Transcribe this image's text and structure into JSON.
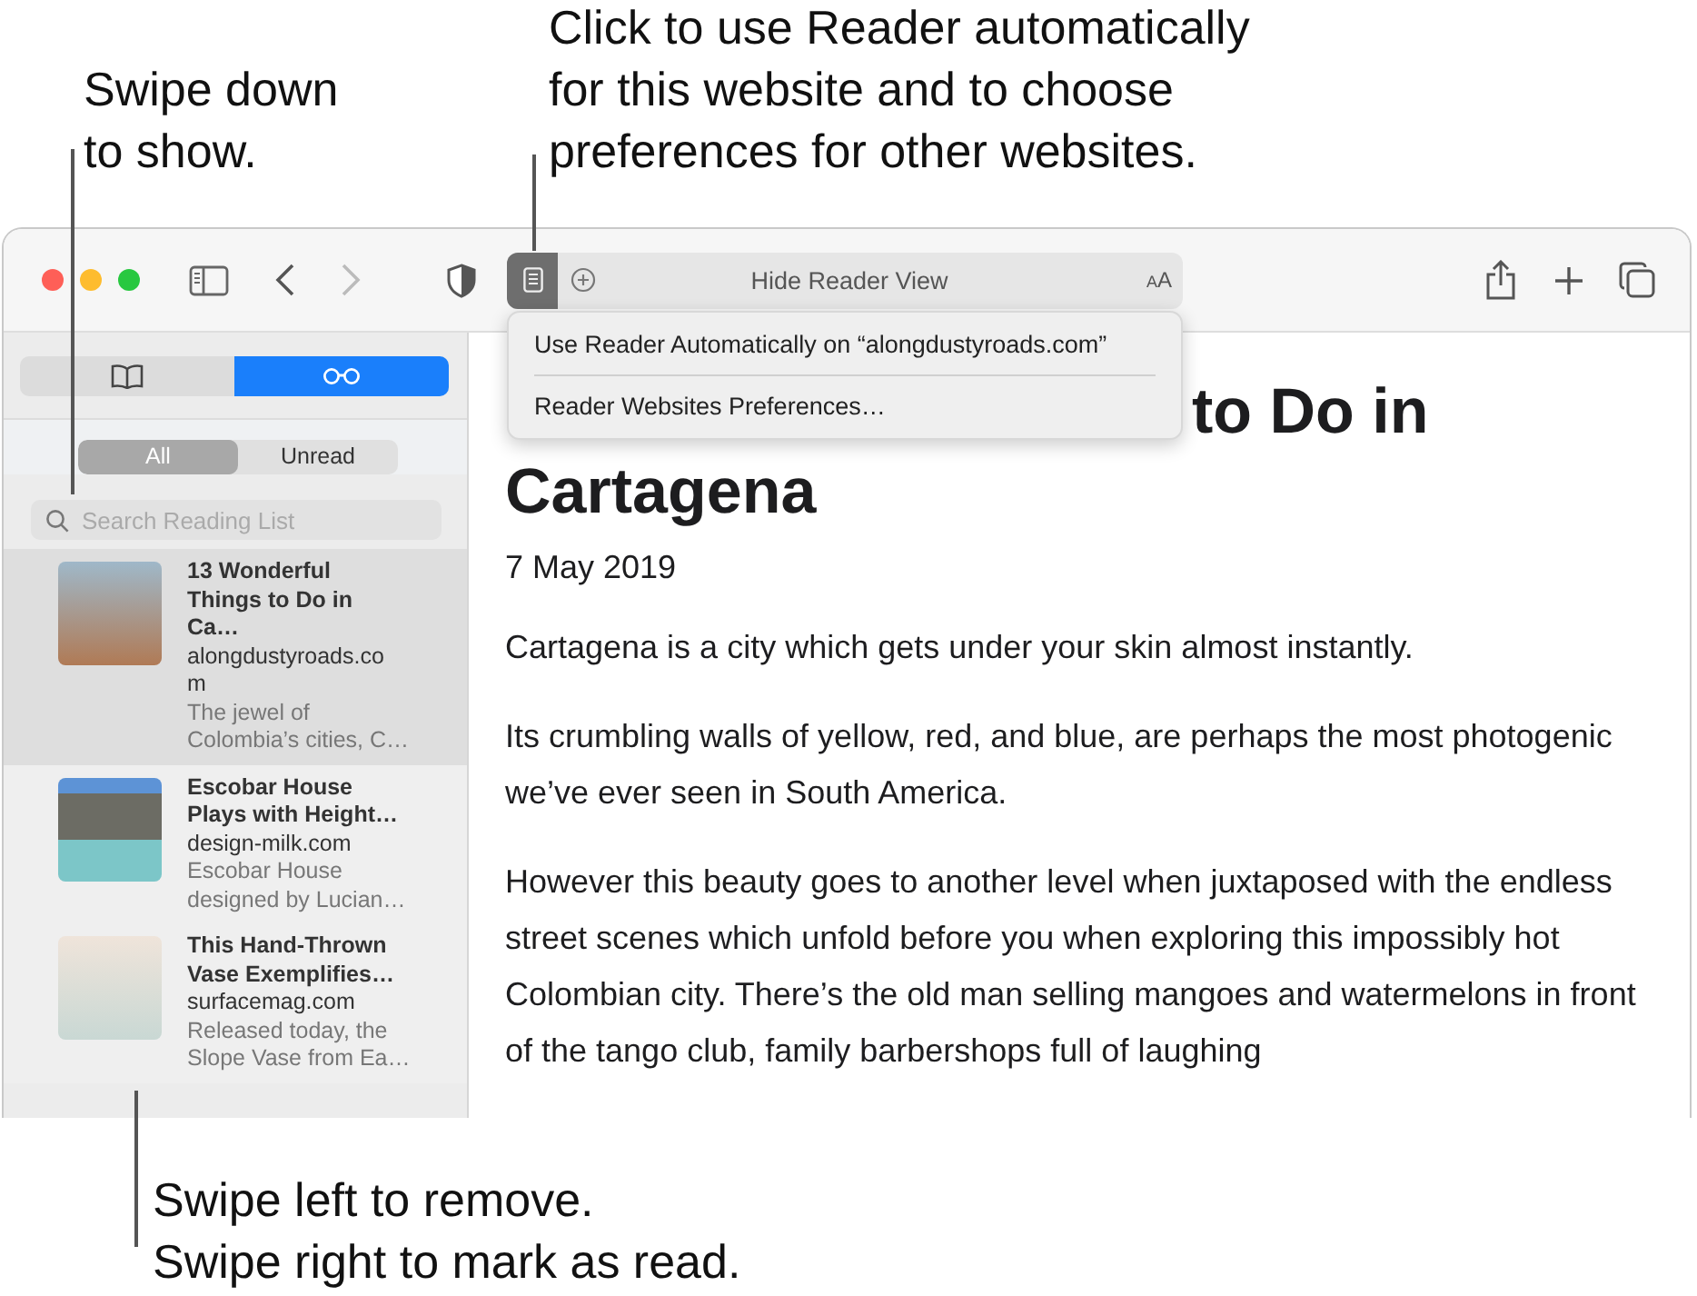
{
  "callouts": {
    "top_left": {
      "lines": [
        "Swipe down",
        "to show."
      ]
    },
    "top_center": {
      "lines": [
        "Click to use Reader automatically",
        "for this website and to choose",
        "preferences for other websites."
      ]
    },
    "bottom": {
      "lines": [
        "Swipe left to remove.",
        "Swipe right to mark as read."
      ]
    }
  },
  "toolbar": {
    "forward_disabled": true,
    "reader_active": true,
    "address_text": "Hide Reader View",
    "text_size_label": "AA"
  },
  "reader_menu": {
    "items": [
      {
        "label": "Use Reader Automatically on “alongdustyroads.com”"
      },
      {
        "label": "Reader Websites Preferences…"
      }
    ]
  },
  "sidebar": {
    "tabs": [
      {
        "kind": "bookmarks",
        "selected": false
      },
      {
        "kind": "reading-list",
        "selected": true
      }
    ],
    "filters": [
      {
        "label": "All",
        "selected": true
      },
      {
        "label": "Unread",
        "selected": false
      }
    ],
    "search": {
      "placeholder": "Search Reading List"
    },
    "items": [
      {
        "title": "13 Wonderful Things to Do in Ca…",
        "domain": "alongdustyroads.com",
        "summary": "The jewel of Colombia’s cities, C…",
        "selected": true
      },
      {
        "title": "Escobar House Plays with Height…",
        "domain": "design-milk.com",
        "summary": "Escobar House designed by Lucian…",
        "selected": false
      },
      {
        "title": "This Hand-Thrown Vase Exemplifies…",
        "domain": "surfacemag.com",
        "summary": "Released today, the Slope Vase from Ea…",
        "selected": false
      }
    ]
  },
  "article": {
    "title_visible_part": "to Do in",
    "title_line_2": "Cartagena",
    "date": "7 May 2019",
    "paragraphs": [
      "Cartagena is a city which gets under your skin almost instantly.",
      "Its crumbling walls of yellow, red, and blue, are perhaps the most photogenic we’ve ever seen in South America.",
      "However this beauty goes to another level when juxtaposed with the endless street scenes which unfold before you when exploring this impossibly hot Colombian city. There’s the old man selling mangoes and watermelons in front of the tango club, family barbershops full of laughing"
    ]
  }
}
